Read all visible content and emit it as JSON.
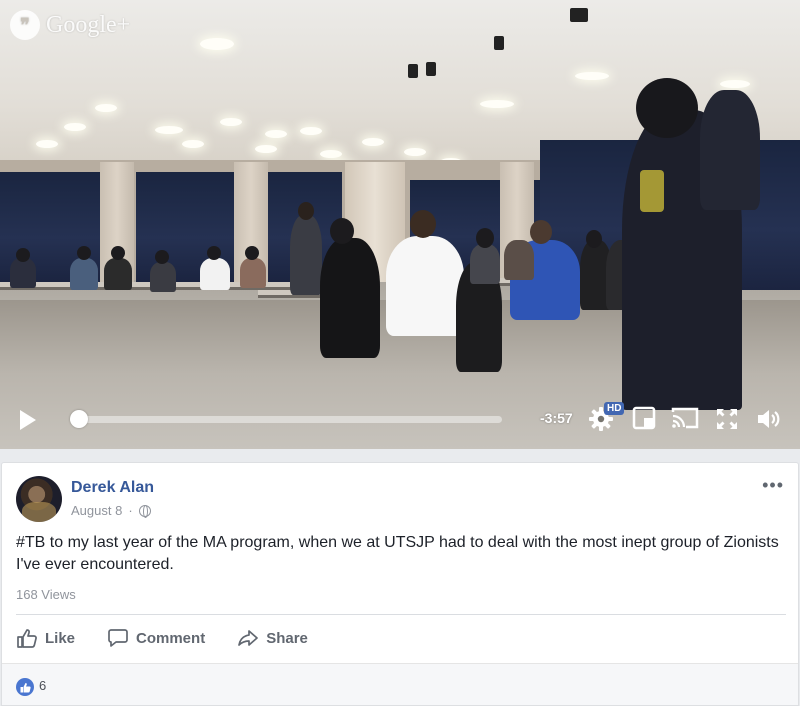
{
  "video": {
    "watermark": "Google+",
    "watermark_icon": "hangouts-quote-icon",
    "time_remaining": "-3:57",
    "progress": 0.02,
    "quality_badge": "HD",
    "controls": [
      "play-icon",
      "settings-gear-icon",
      "fullscreen-toggle-icon",
      "cast-icon",
      "expand-icon",
      "volume-icon"
    ]
  },
  "post": {
    "author": "Derek Alan",
    "date": "August 8",
    "date_separator": "·",
    "privacy_icon": "globe-icon",
    "more_label": "•••",
    "text": "#TB to my last year of the MA program, when we at UTSJP had to deal with the most inept group of Zionists I've ever encountered.",
    "views": "168 Views",
    "actions": {
      "like": "Like",
      "comment": "Comment",
      "share": "Share"
    },
    "reactions": {
      "like_count": "6",
      "accent": "#4a76d0"
    },
    "colors": {
      "author_link": "#365899",
      "meta": "#90949c"
    }
  }
}
